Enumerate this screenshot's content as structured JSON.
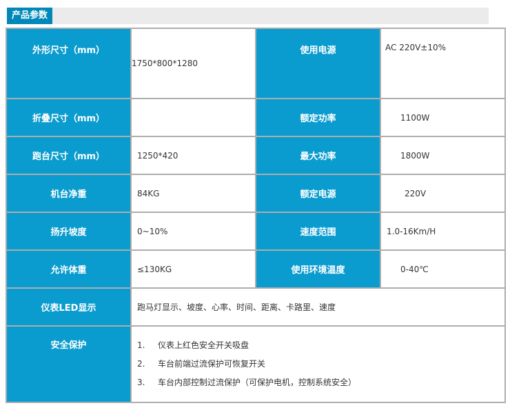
{
  "header": {
    "title": "产品参数"
  },
  "rows": [
    {
      "label_left": "外形尺寸（mm）",
      "value_left": "1750*800*1280",
      "label_right": "使用电源",
      "value_right": "AC 220V±10%"
    },
    {
      "label_left": "折叠尺寸（mm）",
      "value_left": "",
      "label_right": "额定功率",
      "value_right": "1100W"
    },
    {
      "label_left": "跑台尺寸（mm）",
      "value_left": "1250*420",
      "label_right": "最大功率",
      "value_right": "1800W"
    },
    {
      "label_left": "机台净重",
      "value_left": "84KG",
      "label_right": "额定电源",
      "value_right": "220V"
    },
    {
      "label_left": "扬升坡度",
      "value_left": "0~10%",
      "label_right": "速度范围",
      "value_right": "1.0-16Km/H"
    },
    {
      "label_left": "允许体重",
      "value_left": "≤130KG",
      "label_right": "使用环境温度",
      "value_right": "0-40℃"
    }
  ],
  "display": {
    "label": "仪表LED显示",
    "value": "跑马灯显示、坡度、心率、时间、距离、卡路里、速度"
  },
  "safety": {
    "label": "安全保护",
    "items": [
      {
        "num": "1.",
        "text": "仪表上红色安全开关吸盘"
      },
      {
        "num": "2.",
        "text": "车台前端过流保护可恢复开关"
      },
      {
        "num": "3.",
        "text": "车台内部控制过流保护（可保护电机，控制系统安全）"
      }
    ]
  },
  "colors": {
    "key_cell": "#0b9ccf",
    "header_tab": "#0088b8",
    "border": "#adadad"
  }
}
